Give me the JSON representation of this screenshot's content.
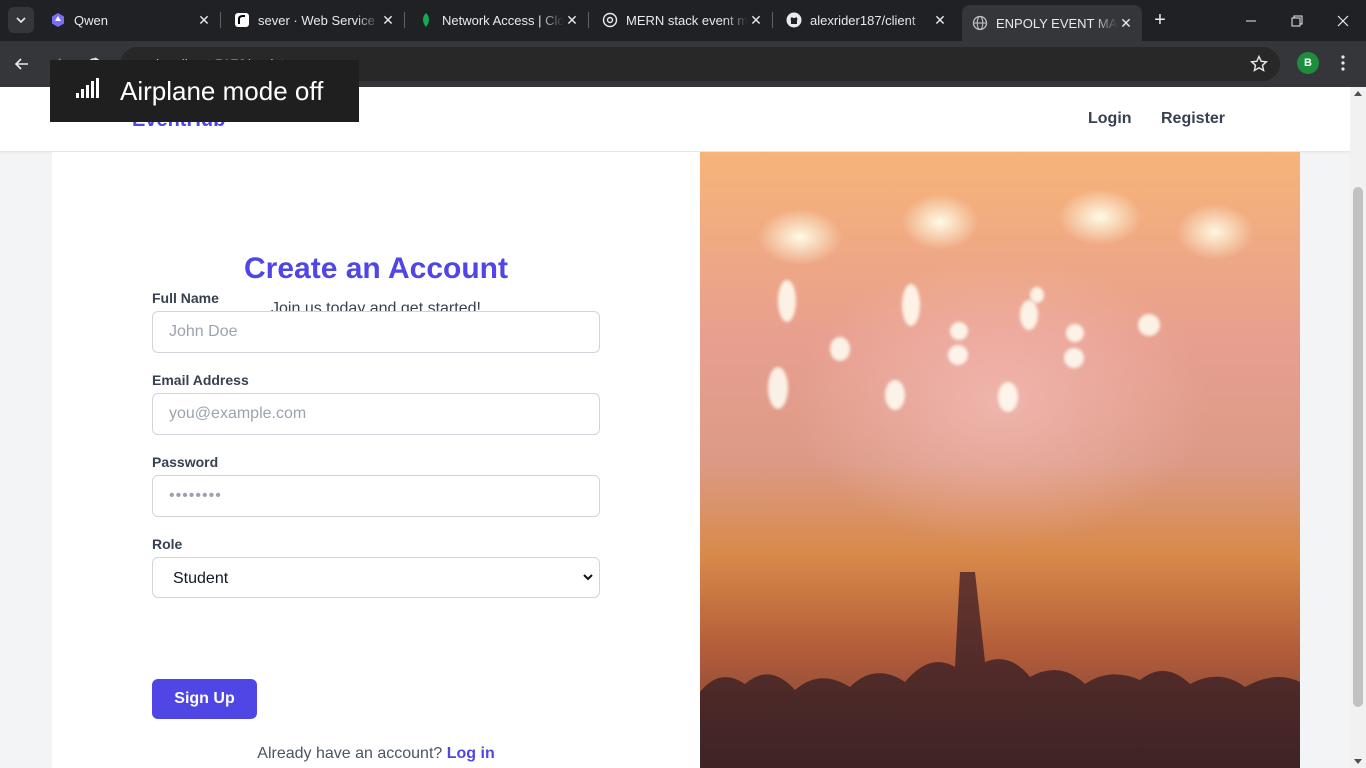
{
  "browser": {
    "tabs": [
      {
        "title": "Qwen",
        "icon": "qwen-icon",
        "active": false
      },
      {
        "title": "sever · Web Service · ",
        "icon": "render-icon",
        "active": false
      },
      {
        "title": "Network Access | Clou",
        "icon": "mongodb-leaf-icon",
        "active": false
      },
      {
        "title": "MERN stack event man",
        "icon": "chatgpt-icon",
        "active": false
      },
      {
        "title": "alexrider187/client",
        "icon": "github-icon",
        "active": false
      },
      {
        "title": "ENPOLY EVENT MANA",
        "icon": "globe-icon",
        "active": true
      }
    ],
    "url": "localhost:5173/register",
    "profile_initial": "B"
  },
  "toast": {
    "text": "Airplane mode off",
    "icon": "signal-bars-icon"
  },
  "site": {
    "brand": "EventHub",
    "nav": {
      "login": "Login",
      "register": "Register"
    }
  },
  "form": {
    "title": "Create an Account",
    "subtitle": "Join us today and get started!",
    "full_name": {
      "label": "Full Name",
      "placeholder": "John Doe"
    },
    "email": {
      "label": "Email Address",
      "placeholder": "you@example.com"
    },
    "password": {
      "label": "Password",
      "placeholder": "••••••••"
    },
    "role": {
      "label": "Role",
      "value": "Student"
    },
    "submit": "Sign Up",
    "footer_text": "Already have an account?",
    "footer_link": "Log in"
  },
  "colors": {
    "accent": "#4f46e5",
    "text": "#374151",
    "muted": "#9ca3af"
  }
}
